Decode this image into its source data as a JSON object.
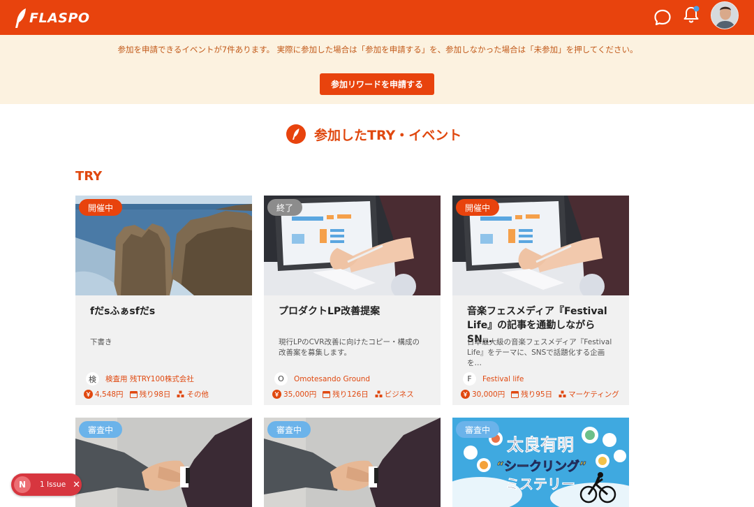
{
  "header": {
    "logo_text": "FLASPO",
    "icons": [
      "chat-icon",
      "bell-icon"
    ],
    "brand_color": "#e8430d",
    "notification_dot_color": "#4aa0e8"
  },
  "notice": {
    "text": "参加を申請できるイベントが7件あります。 実際に参加した場合は「参加を申請する」を、参加しなかった場合は「未参加」を押してください。",
    "button_label": "参加リワードを申請する"
  },
  "section": {
    "title": "参加したTRY・イベント",
    "category_title": "TRY"
  },
  "cards": [
    {
      "status": "開催中",
      "title": "fだsふぁsfだs",
      "desc": "下書き",
      "org_initial": "検",
      "org_name": "検査用 残TRY100株式会社",
      "reward": "4,548円",
      "remaining": "残り98日",
      "category": "その他"
    },
    {
      "status": "終了",
      "title": "プロダクトLP改善提案",
      "desc": "現行LPのCVR改善に向けたコピー・構成の改善案を募集します。",
      "org_initial": "O",
      "org_name": "Omotesando Ground",
      "reward": "35,000円",
      "remaining": "残り126日",
      "category": "ビジネス"
    },
    {
      "status": "開催中",
      "title": "音楽フェスメディア『Festival Life』の記事を通勤しながらSN…",
      "desc": "日本最大級の音楽フェスメディア『Festival Life』をテーマに、SNSで話題化する企画を…",
      "org_initial": "F",
      "org_name": "Festival life",
      "reward": "30,000円",
      "remaining": "残り95日",
      "category": "マーケティング"
    },
    {
      "status": "審査中"
    },
    {
      "status": "審査中"
    },
    {
      "status": "審査中",
      "poster_title_1": "太良有明",
      "poster_title_2": "“シークリング”",
      "poster_title_3": "ミステリー"
    }
  ],
  "issue_widget": {
    "initial": "N",
    "label": "1 Issue",
    "close": "✕"
  }
}
